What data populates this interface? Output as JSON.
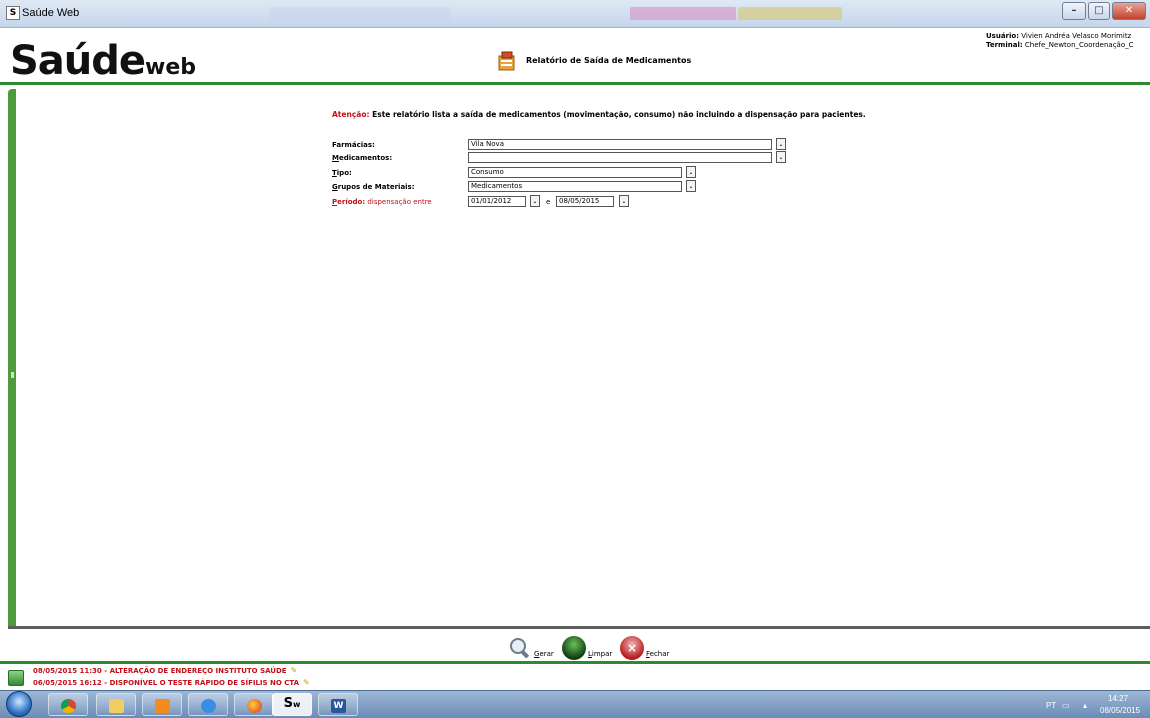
{
  "window": {
    "app_icon_text": "S",
    "title": "Saúde Web",
    "buttons": {
      "minimize": "–",
      "maximize": "□",
      "close": "✕"
    }
  },
  "header": {
    "logo_main": "Saúde",
    "logo_sub": "web",
    "report_title": "Relatório de Saída de Medicamentos",
    "user_label": "Usuário:",
    "user_value": "Vivien Andréa Velasco Morimitz",
    "terminal_label": "Terminal:",
    "terminal_value": "Chefe_Newton_Coordenação_C"
  },
  "notice": {
    "label": "Atenção:",
    "text": "Este relatório lista a saída de medicamentos (movimentação, consumo) não incluindo a dispensação para pacientes."
  },
  "form": {
    "farmacias": {
      "label_first": "F",
      "label_rest": "armácias:",
      "value": "Vila Nova",
      "button": "."
    },
    "medicamentos": {
      "label_first": "M",
      "label_rest": "edicamentos:",
      "value": "",
      "button": "."
    },
    "tipo": {
      "label_first": "T",
      "label_rest": "ipo:",
      "value": "Consumo",
      "button": "."
    },
    "grupos": {
      "label_first": "G",
      "label_rest": "rupos de Materiais:",
      "value": "Medicamentos",
      "button": "."
    },
    "periodo": {
      "label_first": "P",
      "label_rest": "eríodo:",
      "label_suffix": "dispensação entre",
      "start": "01/01/2012",
      "and_text": "e",
      "end": "08/05/2015",
      "button": "."
    }
  },
  "actions": {
    "gerar": {
      "first": "G",
      "rest": "erar"
    },
    "limpar": {
      "first": "L",
      "rest": "impar"
    },
    "fechar": {
      "first": "F",
      "rest": "echar"
    }
  },
  "news": [
    "08/05/2015 11:30 - ALTERAÇÃO DE ENDEREÇO INSTITUTO SAÚDE",
    "06/05/2015 16:12 - DISPONÍVEL O TESTE RÁPIDO DE SÍFILIS NO CTA"
  ],
  "taskbar": {
    "sw_label": "S",
    "sw_sub": "w",
    "word_label": "W",
    "language": "PT",
    "time": "14:27",
    "date": "08/05/2015"
  },
  "colors": {
    "accent_green": "#2f8a2f",
    "alert_red": "#c0101a"
  }
}
